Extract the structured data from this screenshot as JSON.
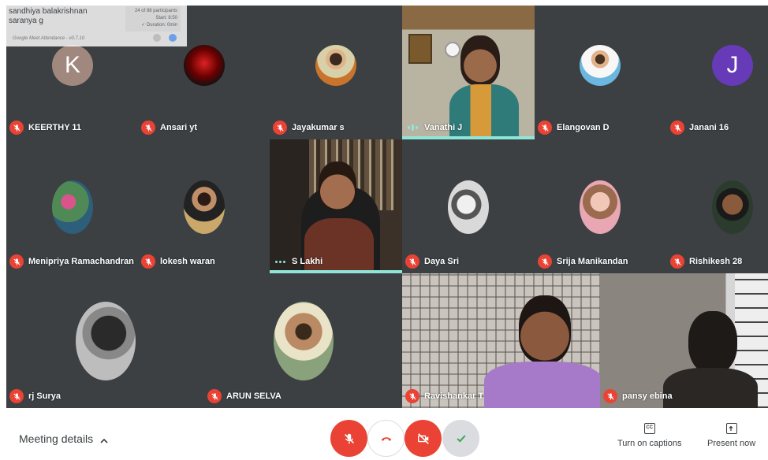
{
  "attendance": {
    "names": [
      "sandhiya balakrishnan",
      "saranya g"
    ],
    "stats": [
      "24 of 88 participants",
      "Start: 8:50",
      "✓ Duration: 0min"
    ],
    "footer": "Google Meet Attendance - v0.7.10"
  },
  "participants": [
    {
      "name": "KEERTHY 11",
      "muted": true,
      "avatar": "letter",
      "letter": "K",
      "color": "#a1887f"
    },
    {
      "name": "Ansari yt",
      "muted": true,
      "avatar": "photo",
      "color": "#8b0000"
    },
    {
      "name": "Jayakumar s",
      "muted": true,
      "avatar": "photo",
      "color": "#c8742c"
    },
    {
      "name": "Vanathi J",
      "muted": false,
      "speaking": true,
      "avatar": "camera"
    },
    {
      "name": "Elangovan D",
      "muted": true,
      "avatar": "photo",
      "color": "#6bb7e0"
    },
    {
      "name": "Janani 16",
      "muted": true,
      "avatar": "letter",
      "letter": "J",
      "color": "#673ab7"
    },
    {
      "name": "Menipriya Ramachandran",
      "muted": true,
      "avatar": "photo",
      "color": "#4f8a56"
    },
    {
      "name": "lokesh waran",
      "muted": true,
      "avatar": "photo",
      "color": "#c9a86a"
    },
    {
      "name": "S Lakhi",
      "muted": false,
      "speaking": true,
      "avatar": "camera"
    },
    {
      "name": "Daya Sri",
      "muted": true,
      "avatar": "photo",
      "color": "#d9d9d9"
    },
    {
      "name": "Srija Manikandan",
      "muted": true,
      "avatar": "photo",
      "color": "#e8a7b3"
    },
    {
      "name": "Rishikesh 28",
      "muted": true,
      "avatar": "photo",
      "color": "#2b3b2e"
    },
    {
      "name": "rj Surya",
      "muted": true,
      "avatar": "photo",
      "color": "#bdbdbd"
    },
    {
      "name": "ARUN SELVA",
      "muted": true,
      "avatar": "photo",
      "color": "#8aa27b"
    },
    {
      "name": "Ravishankar T",
      "muted": true,
      "avatar": "camera"
    },
    {
      "name": "pansy ebina",
      "muted": true,
      "avatar": "camera"
    }
  ],
  "bottombar": {
    "meeting_details": "Meeting details",
    "captions_label": "Turn on captions",
    "captions_icon_text": "CC",
    "present_label": "Present now"
  },
  "colors": {
    "mute_red": "#ea4335",
    "speaking_teal": "#8ee6d8",
    "tile_bg": "#3c4043",
    "grid_bg": "#202124"
  }
}
